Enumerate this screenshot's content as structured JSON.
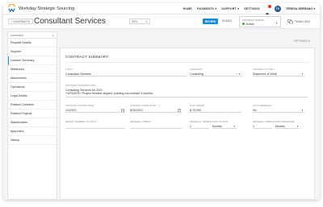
{
  "app": {
    "title": "Workday Strategic Sourcing"
  },
  "topnav": {
    "items": [
      "HOME",
      "PAYMENTS ▾",
      "SUPPORT ▾",
      "SETTINGS"
    ],
    "user_initials": "TS",
    "user_name": "TERESA SERRANO ▾"
  },
  "header": {
    "back_link": "‹ CONTRACTS",
    "title": "Consultant Services",
    "status_select": "NEW",
    "review_label": "REVIEW",
    "contract_id": "ID 8203",
    "contract_status_label": "CONTRACT STATUS",
    "contract_status_value": "Active",
    "team_chat": "TEAM CHAT"
  },
  "sidebar": {
    "head_label": "CONTRACT",
    "collapse_icon": "|‹",
    "items": [
      {
        "label": "Request Details",
        "active": false
      },
      {
        "label": "Supplier",
        "active": false
      },
      {
        "label": "Contract Summary",
        "active": true
      },
      {
        "label": "Milestones",
        "active": false
      },
      {
        "label": "Attachments",
        "active": false
      },
      {
        "label": "Operations",
        "active": false
      },
      {
        "label": "Legal Details",
        "active": false
      },
      {
        "label": "Related Contracts",
        "active": false
      },
      {
        "label": "Related Projects",
        "active": false
      },
      {
        "label": "Stakeholders",
        "active": false
      },
      {
        "label": "Approvers",
        "active": false
      },
      {
        "label": "History",
        "active": false
      }
    ]
  },
  "main": {
    "options_label": "OPTIONS ▾",
    "card_title": "CONTRACT SUMMARY",
    "fields": {
      "title_label": "TITLE *",
      "title_value": "Consultant Services",
      "category_label": "CATEGORY",
      "category_value": "Consulting",
      "type_label": "CONTRACT TYPE *",
      "type_value": "Statement of Work",
      "description_label": "CONTRACT DESCRIPTION",
      "description_line1": "Consulting Services for 2021",
      "description_line2": "**UPDATE** Project timeline slipped, pushing out contract 3 months.",
      "start_label": "CONTRACT START DATE *",
      "start_value": "1/1/2021",
      "end_label": "CONTRACT END DATE * ⓘ",
      "end_value": "8/30/2021",
      "spend_label": "FULL SPEND",
      "spend_value": "$ 75,000",
      "auto_renewal_label": "AUTO RENEWAL *",
      "auto_renewal_value": "No",
      "renewal_days_label": "RENEW NUMBER OF DAYS *",
      "renewal_terms_label": "RENEWAL TERMS *",
      "termination_notice_label": "RENEWAL TERMINATION NOTICE",
      "termination_notice_num": "1",
      "termination_notice_unit": "Months",
      "termination_reminder_label": "RENEWAL TERMINATION REMINDER",
      "termination_reminder_num": "1",
      "termination_reminder_unit": "Months"
    }
  },
  "colors": {
    "accent": "#1a88d8",
    "active_status": "#3cb043",
    "avatar": "#2b5a8c",
    "notification": "#e0312f"
  },
  "icons": {
    "logo": "workday-logo-icon",
    "bell": "bell-icon",
    "chat": "chat-icon",
    "calendar": "calendar-icon"
  }
}
